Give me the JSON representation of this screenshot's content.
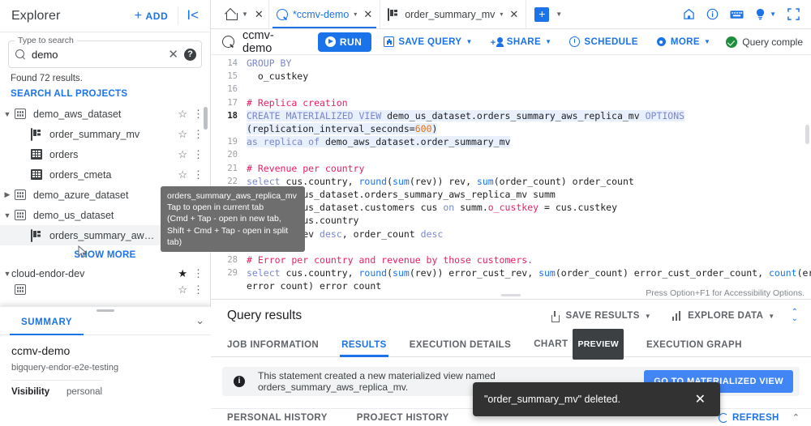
{
  "explorer": {
    "title": "Explorer",
    "add_label": "ADD",
    "collapse_icon": "collapse-panel-icon",
    "search": {
      "legend": "Type to search",
      "value": "demo",
      "clear_icon": "close-icon",
      "help_icon": "help-icon"
    },
    "found_text": "Found 72 results.",
    "search_all_label": "SEARCH ALL PROJECTS",
    "tree": [
      {
        "label": "demo_aws_dataset",
        "icon": "dataset-icon",
        "indent": 0,
        "caret": "expanded",
        "starred": false,
        "selected": false
      },
      {
        "label": "order_summary_mv",
        "icon": "materialized-view-icon",
        "indent": 1,
        "caret": "none",
        "starred": false,
        "selected": false
      },
      {
        "label": "orders",
        "icon": "table-icon",
        "indent": 1,
        "caret": "none",
        "starred": false,
        "selected": false
      },
      {
        "label": "orders_cmeta",
        "icon": "table-icon",
        "indent": 1,
        "caret": "none",
        "starred": false,
        "selected": false
      },
      {
        "label": "demo_azure_dataset",
        "icon": "dataset-icon",
        "indent": 0,
        "caret": "collapsed",
        "starred": false,
        "selected": false
      },
      {
        "label": "demo_us_dataset",
        "icon": "dataset-icon",
        "indent": 0,
        "caret": "expanded",
        "starred": false,
        "selected": false
      },
      {
        "label": "orders_summary_aw…",
        "icon": "materialized-view-icon",
        "indent": 1,
        "caret": "none",
        "starred": false,
        "selected": true
      }
    ],
    "show_more_label": "SHOW MORE",
    "project_row": {
      "label": "cloud-endor-dev",
      "caret": "expanded",
      "starred": true
    }
  },
  "tree_tooltip": {
    "line1": "orders_summary_aws_replica_mv",
    "line2": "Tap to open in current tab",
    "line3": "(Cmd + Tap - open in new tab,",
    "line4": "Shift + Cmd + Tap - open in split tab)"
  },
  "summary": {
    "tab_label": "SUMMARY",
    "chevron_icon": "chevron-down-icon",
    "title": "ccmv-demo",
    "subtitle": "bigquery-endor-e2e-testing",
    "visibility_key": "Visibility",
    "visibility_value": "personal"
  },
  "tabstrip": {
    "home_tab": {
      "icon": "home-icon",
      "caret": "▾",
      "close": "✕"
    },
    "tabs": [
      {
        "label": "*ccmv-demo",
        "icon": "query-icon",
        "active": true,
        "caret": "▾",
        "close": "✕"
      },
      {
        "label": "order_summary_mv",
        "icon": "materialized-view-icon",
        "active": false,
        "caret": "▾",
        "close": "✕"
      }
    ],
    "new_tab_label": "+",
    "new_tab_caret": "▾",
    "right_icons": [
      "home-icon",
      "info-icon",
      "keyboard-icon",
      "lightbulb-icon",
      "fullscreen-icon"
    ]
  },
  "query_toolbar": {
    "search_icon": "query-search-icon",
    "query_name": "ccmv-demo",
    "run_label": "RUN",
    "save_query_label": "SAVE QUERY",
    "share_label": "SHARE",
    "schedule_label": "SCHEDULE",
    "more_label": "MORE",
    "status_text": "Query comple"
  },
  "editor": {
    "accessibility_hint": "Press Option+F1 for Accessibility Options.",
    "lines": [
      {
        "num": "14",
        "current": false,
        "html": "<span class='kw'>GROUP BY</span>"
      },
      {
        "num": "15",
        "current": false,
        "html": "  o_custkey"
      },
      {
        "num": "16",
        "current": false,
        "html": ""
      },
      {
        "num": "17",
        "current": false,
        "html": "<span class='cmt'># Replica creation</span>"
      },
      {
        "num": "18",
        "current": true,
        "html": "<span class='sel-bg'><span class='kw'>CREATE MATERIALIZED VIEW</span> demo_us_dataset.orders_summary_aws_replica_mv <span class='kw'>OPTIONS</span></span>"
      },
      {
        "num": "",
        "current": false,
        "html": "<span class='sel-bg'>(replication_interval_seconds=<span class='num'>600</span>)</span>"
      },
      {
        "num": "19",
        "current": false,
        "html": "<span class='sel-bg'><span class='kw'>as replica of</span> demo_aws_dataset.order_summary_mv</span>"
      },
      {
        "num": "20",
        "current": false,
        "html": ""
      },
      {
        "num": "21",
        "current": false,
        "html": "<span class='cmt'># Revenue per country</span>"
      },
      {
        "num": "22",
        "current": false,
        "html": "<span class='kw'>select</span> cus.country, <span class='fn'>round</span>(<span class='fn'>sum</span>(rev)) rev, <span class='fn'>sum</span>(order_count) order_count"
      },
      {
        "num": "23",
        "current": false,
        "html": "<span class='kw'>from</span> demo_us_dataset.orders_summary_aws_replica_mv summ"
      },
      {
        "num": "24",
        "current": false,
        "html": "<span class='kw'>join</span> demo_us_dataset.customers cus <span class='kw'>on</span> summ.<span class='cmt'>o_custkey</span> = cus.custkey"
      },
      {
        "num": "25",
        "current": false,
        "html": "<span class='kw'>group by</span> cus.country"
      },
      {
        "num": "26",
        "current": false,
        "html": "<span class='kw'>order by</span> rev <span class='kw'>desc</span>, order_count <span class='kw'>desc</span>"
      },
      {
        "num": "27",
        "current": false,
        "html": ""
      },
      {
        "num": "28",
        "current": false,
        "html": "<span class='cmt'># Error per country and revenue by those customers.</span>"
      },
      {
        "num": "29",
        "current": false,
        "html": "<span class='kw'>select</span> cus.country, <span class='fn'>round</span>(<span class='fn'>sum</span>(rev)) error_cust_rev, <span class='fn'>sum</span>(order_count) error_cust_order_count, <span class='fn'>count</span>(err."
      },
      {
        "num": "",
        "current": false,
        "html": "error count) error count"
      }
    ]
  },
  "results": {
    "title": "Query results",
    "save_results_label": "SAVE RESULTS",
    "explore_data_label": "EXPLORE DATA",
    "expand_icon": "expand-collapse-icon",
    "tabs": [
      {
        "label": "JOB INFORMATION",
        "active": false,
        "badge": ""
      },
      {
        "label": "RESULTS",
        "active": true,
        "badge": ""
      },
      {
        "label": "EXECUTION DETAILS",
        "active": false,
        "badge": ""
      },
      {
        "label": "CHART",
        "active": false,
        "badge": "PREVIEW"
      },
      {
        "label": "EXECUTION GRAPH",
        "active": false,
        "badge": ""
      }
    ],
    "banner": {
      "icon": "info-icon",
      "text": "This statement created a new materialized view named orders_summary_aws_replica_mv.",
      "button_label": "GO TO MATERIALIZED VIEW"
    },
    "history_tabs": [
      "PERSONAL HISTORY",
      "PROJECT HISTORY"
    ],
    "refresh_label": "REFRESH",
    "collapse_icon": "chevron-up-icon"
  },
  "toast": {
    "message": "\"order_summary_mv\" deleted.",
    "close_icon": "close-icon"
  },
  "colors": {
    "accent": "#1a73e8",
    "success": "#1e8e3e",
    "toast_bg": "#323232",
    "tooltip_bg": "#6e6e6e",
    "banner_bg": "#f1f3f4",
    "goto_button": "#4285f4"
  }
}
